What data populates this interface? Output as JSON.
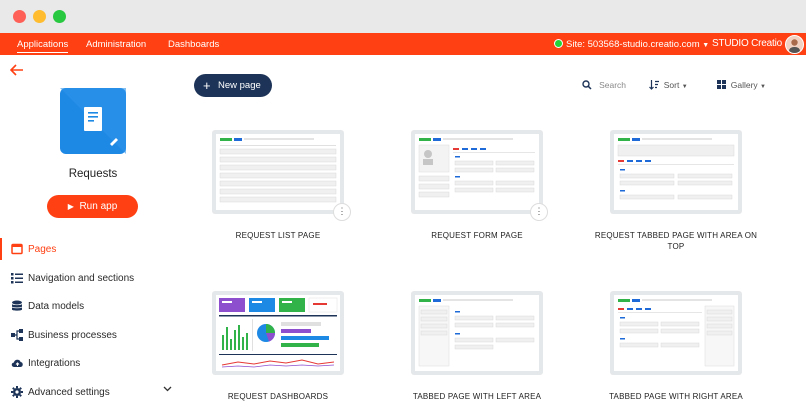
{
  "topnav": {
    "tabs": [
      "Applications",
      "Administration",
      "Dashboards"
    ],
    "site": "Site: 503568-studio.creatio.com",
    "site_dropdown_icon": "chevron-down-icon",
    "studio": "STUDIO Creatio"
  },
  "sidebar": {
    "app_title": "Requests",
    "run_label": "Run app",
    "items": [
      {
        "label": "Pages",
        "icon": "page-icon"
      },
      {
        "label": "Navigation and sections",
        "icon": "list-icon"
      },
      {
        "label": "Data models",
        "icon": "database-icon"
      },
      {
        "label": "Business processes",
        "icon": "process-icon"
      },
      {
        "label": "Integrations",
        "icon": "cloud-icon"
      },
      {
        "label": "Advanced settings",
        "icon": "gear-icon"
      }
    ]
  },
  "toolbar": {
    "new_page": "New page",
    "search": "Search",
    "sort": "Sort",
    "view": "Gallery"
  },
  "cards": [
    {
      "label": "REQUEST LIST PAGE"
    },
    {
      "label": "REQUEST FORM PAGE"
    },
    {
      "label": "REQUEST TABBED PAGE WITH AREA ON TOP"
    },
    {
      "label": "REQUEST DASHBOARDS"
    },
    {
      "label": "TABBED PAGE WITH LEFT AREA"
    },
    {
      "label": "TABBED PAGE WITH RIGHT AREA"
    }
  ],
  "colors": {
    "accent": "#ff4013",
    "button_dark": "#1d3458",
    "app_icon": "#1e88e5"
  }
}
